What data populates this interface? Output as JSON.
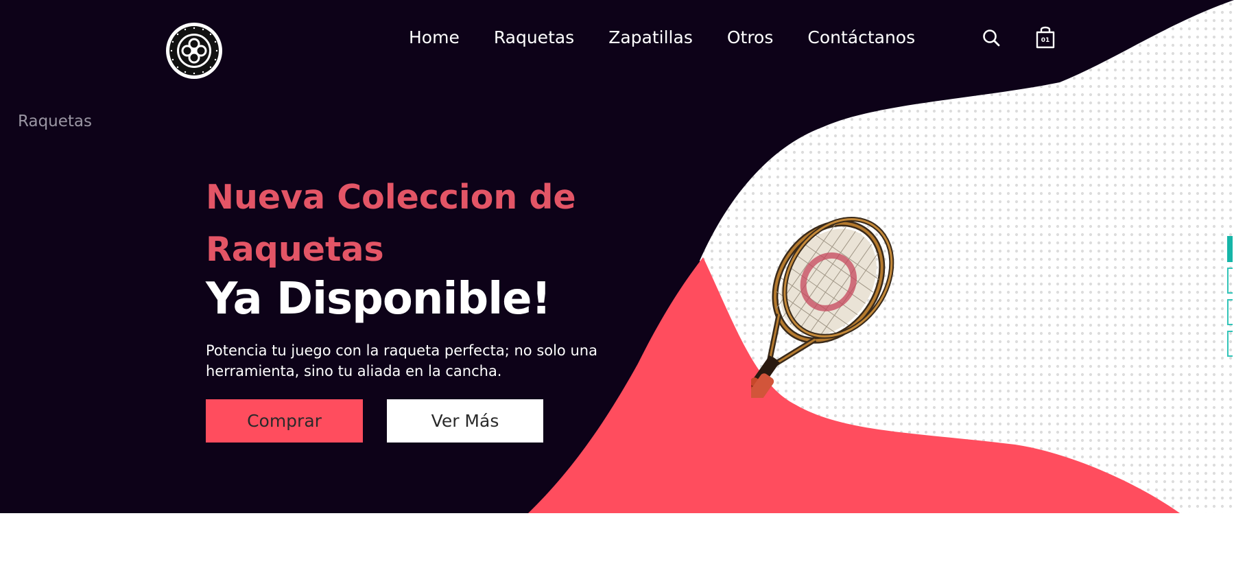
{
  "header": {
    "logo_name": "round-monogram-logo",
    "nav": [
      {
        "label": "Home"
      },
      {
        "label": "Raquetas"
      },
      {
        "label": "Zapatillas"
      },
      {
        "label": "Otros"
      },
      {
        "label": "Contáctanos"
      }
    ],
    "cart_count": "01"
  },
  "breadcrumb": "Raquetas",
  "hero": {
    "title_light": "Nueva Coleccion de Raquetas",
    "title_bold": "Ya Disponible!",
    "description": "Potencia tu juego con la raqueta perfecta; no solo una herramienta, sino tu aliada en la cancha.",
    "buy_label": "Comprar",
    "more_label": "Ver Más"
  },
  "slider": {
    "count": 4,
    "active_index": 0
  },
  "colors": {
    "background": "#0d0218",
    "accent": "#ff4d5e",
    "title_light": "#e35566",
    "indicator": "#16b5a8"
  }
}
